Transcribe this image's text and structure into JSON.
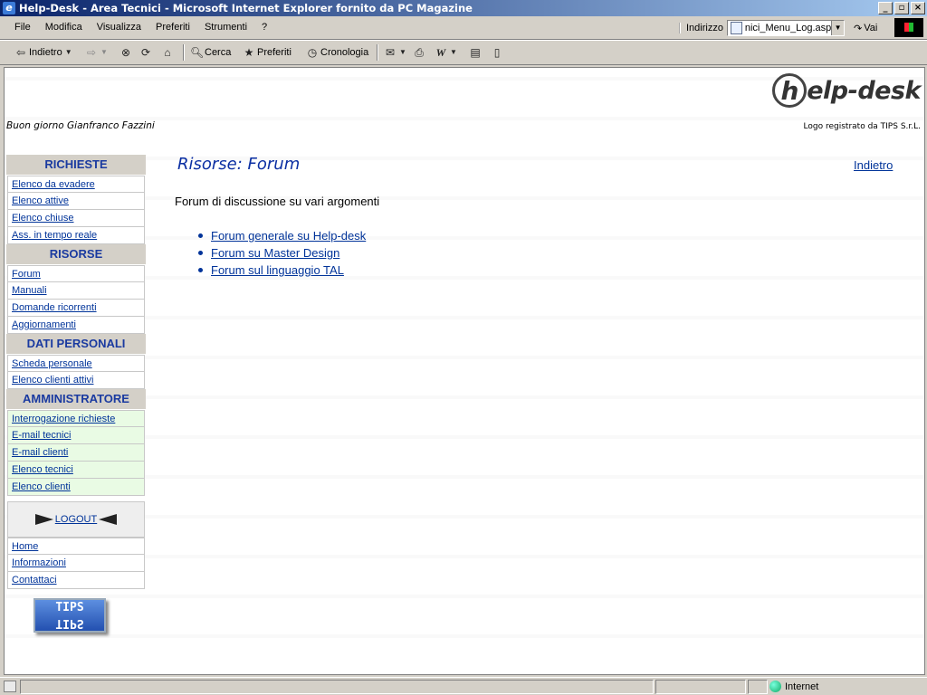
{
  "window": {
    "title": "Help-Desk - Area Tecnici - Microsoft Internet Explorer fornito da PC Magazine"
  },
  "menubar": {
    "items": [
      "File",
      "Modifica",
      "Visualizza",
      "Preferiti",
      "Strumenti",
      "?"
    ]
  },
  "address": {
    "label": "Indirizzo",
    "value": "nici_Menu_Log.asp",
    "go_label": "Vai"
  },
  "toolbar": {
    "back": "Indietro",
    "search": "Cerca",
    "favorites": "Preferiti",
    "history": "Cronologia"
  },
  "page": {
    "logo_text": "elp-desk",
    "logo_letter": "h",
    "logo_note": "Logo registrato da TIPS S.r.L.",
    "greeting": "Buon giorno Gianfranco Fazzini",
    "title": "Risorse: Forum",
    "back_link": "Indietro",
    "intro": "Forum di discussione su vari argomenti",
    "forums": [
      "Forum generale su Help-desk",
      "Forum su Master Design",
      "Forum sul linguaggio TAL"
    ]
  },
  "sidebar": {
    "sections": [
      {
        "title": "RICHIESTE",
        "items": [
          "Elenco da evadere",
          "Elenco attive",
          "Elenco chiuse",
          "Ass. in tempo reale"
        ]
      },
      {
        "title": "RISORSE",
        "items": [
          "Forum",
          "Manuali",
          "Domande ricorrenti",
          "Aggiornamenti"
        ]
      },
      {
        "title": "DATI PERSONALI",
        "items": [
          "Scheda personale",
          "Elenco clienti attivi"
        ]
      },
      {
        "title": "AMMINISTRATORE",
        "items": [
          "Interrogazione richieste",
          "E-mail tecnici",
          "E-mail clienti",
          "Elenco tecnici",
          "Elenco clienti"
        ]
      }
    ],
    "logout": "LOGOUT",
    "footer_links": [
      "Home",
      "Informazioni",
      "Contattaci"
    ],
    "tips_top": "TIPS",
    "tips_bottom": "TIPS"
  },
  "status": {
    "zone": "Internet"
  },
  "colors": {
    "title_gradient_start": "#0a246a",
    "link": "#003399",
    "section_header_text": "#1a3aa0",
    "admin_row_bg": "#e9fbe4"
  }
}
